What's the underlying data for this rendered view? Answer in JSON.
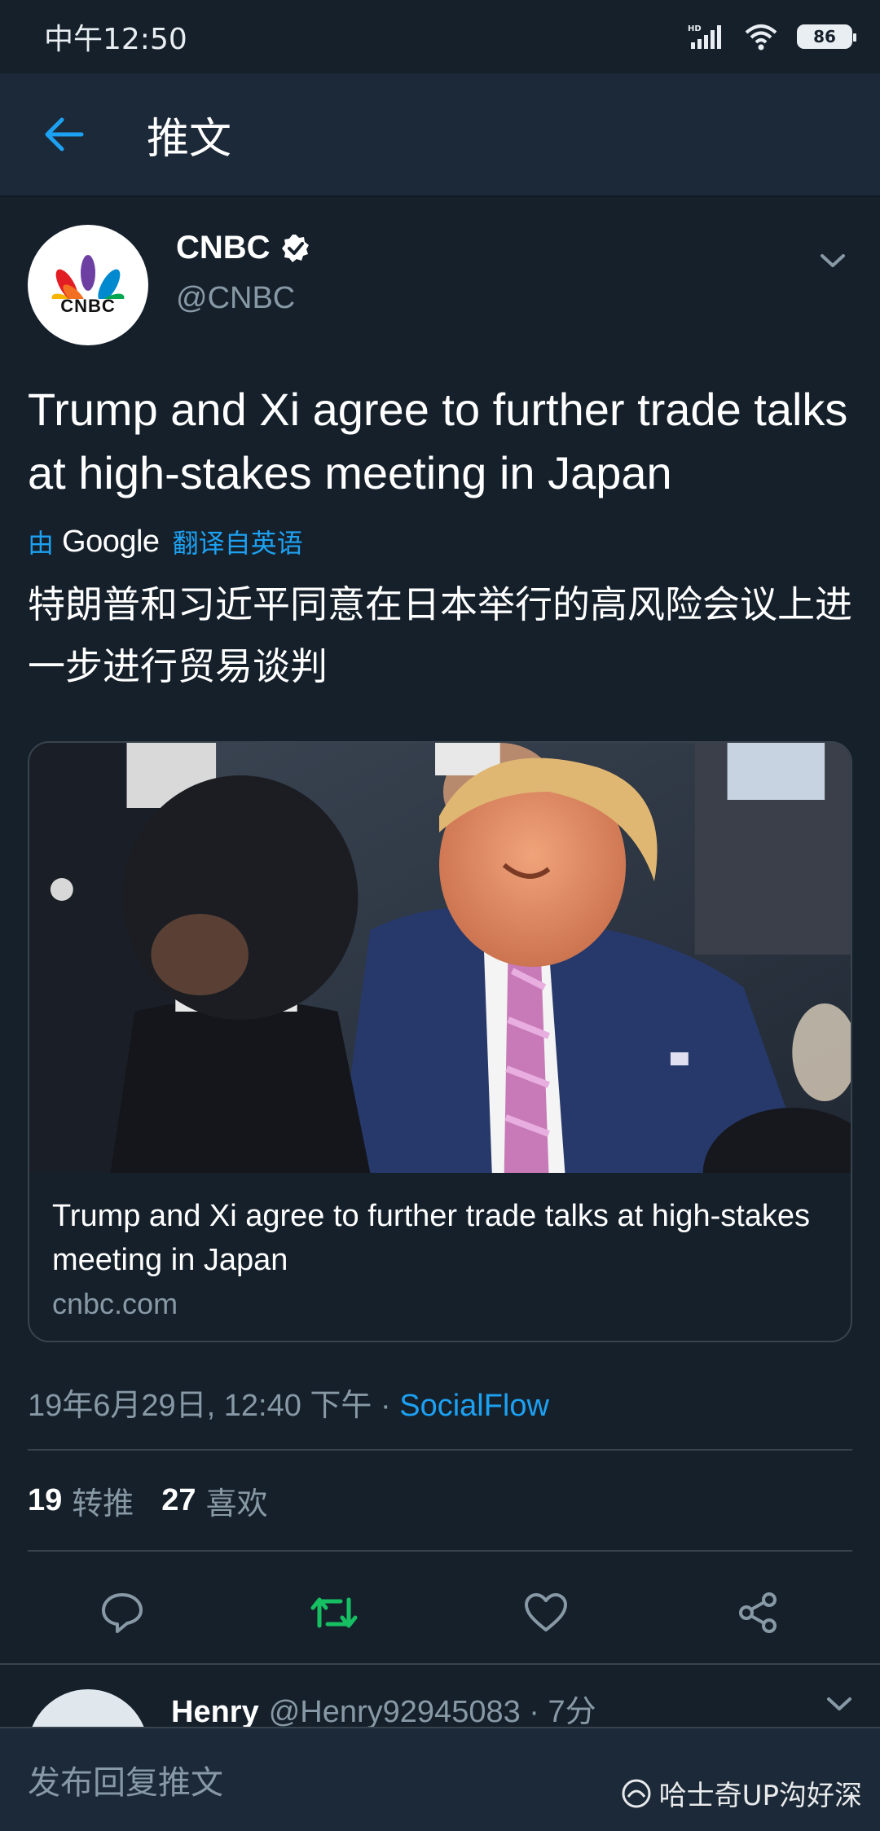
{
  "status_bar": {
    "time": "中午12:50",
    "battery": "86",
    "network": "HD"
  },
  "app_bar": {
    "title": "推文"
  },
  "tweet": {
    "author_name": "CNBC",
    "author_handle": "@CNBC",
    "avatar_label": "CNBC",
    "text": "Trump and Xi agree to further trade talks at high-stakes meeting in Japan",
    "translation": {
      "prefix": "由",
      "provider": "Google",
      "suffix": "翻译自英语",
      "text": "特朗普和习近平同意在日本举行的高风险会议上进一步进行贸易谈判"
    },
    "card": {
      "title": "Trump and Xi agree to further trade talks at high-stakes meeting in Japan",
      "domain": "cnbc.com"
    },
    "meta": {
      "timestamp": "19年6月29日, 12:40 下午 · ",
      "source": "SocialFlow"
    },
    "stats": {
      "retweets_count": "19",
      "retweets_label": "转推",
      "likes_count": "27",
      "likes_label": "喜欢"
    }
  },
  "reply": {
    "name": "Henry",
    "handle_time": "@Henry92945083 · 7分"
  },
  "compose": {
    "placeholder": "发布回复推文"
  },
  "watermark": {
    "text": "哈士奇UP沟好深"
  },
  "colors": {
    "background": "#15202b",
    "accent": "#1da1f2",
    "retweet": "#17bf63",
    "muted": "#8899a6"
  }
}
